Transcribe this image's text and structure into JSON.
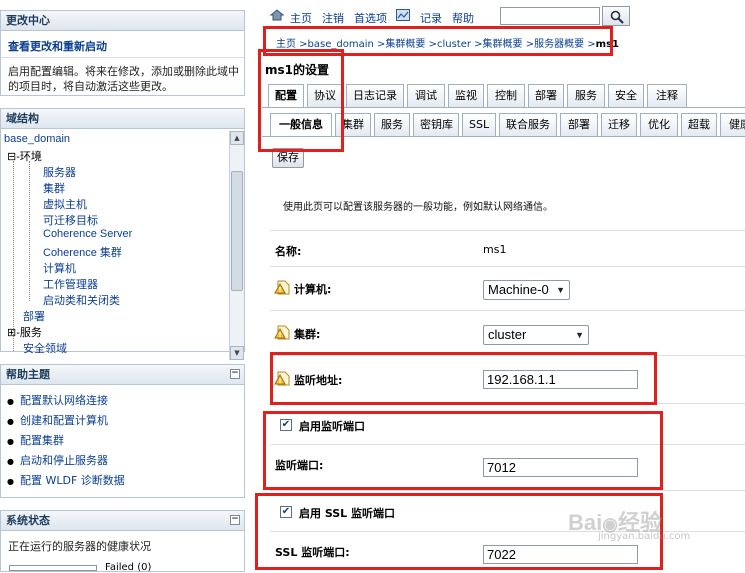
{
  "change_center": {
    "title": "更改中心",
    "link": "查看更改和重新启动",
    "description_line1": "启用配置编辑。将来在修改，添加或删除此域中",
    "description_line2": "的项目时，将自动激活这些更改。"
  },
  "domain_structure": {
    "title": "域结构",
    "items": [
      {
        "label": "base_domain"
      },
      {
        "label": "⊟-环境"
      },
      {
        "label": "服务器"
      },
      {
        "label": "集群"
      },
      {
        "label": "虚拟主机"
      },
      {
        "label": "可迁移目标"
      },
      {
        "label": "Coherence Server"
      },
      {
        "label": "Coherence 集群"
      },
      {
        "label": "计算机"
      },
      {
        "label": "工作管理器"
      },
      {
        "label": "启动类和关闭类"
      },
      {
        "label": "部署"
      },
      {
        "label": "⊞-服务"
      },
      {
        "label": "安全领域"
      }
    ]
  },
  "help_topics": {
    "title": "帮助主题",
    "items": [
      "配置默认网络连接",
      "创建和配置计算机",
      "配置集群",
      "启动和停止服务器",
      "配置 WLDF 诊断数据"
    ]
  },
  "system_status": {
    "title": "系统状态",
    "subtitle": "正在运行的服务器的健康状况",
    "partial": "Failed (0)"
  },
  "toolbar": {
    "home": "主页",
    "logout": "注销",
    "preferences": "首选项",
    "record": "记录",
    "help": "帮助"
  },
  "breadcrumb": {
    "path": "主页 >base_domain >集群概要 >cluster >集群概要 >服务器概要 >",
    "current": "ms1"
  },
  "settings_title": "ms1的设置",
  "tabs_top": [
    "配置",
    "协议",
    "日志记录",
    "调试",
    "监视",
    "控制",
    "部署",
    "服务",
    "安全",
    "注释"
  ],
  "tabs_sub": [
    "一般信息",
    "集群",
    "服务",
    "密钥库",
    "SSL",
    "联合服务",
    "部署",
    "迁移",
    "优化",
    "超载",
    "健康"
  ],
  "save_label": "保存",
  "description": "使用此页可以配置该服务器的一般功能，例如默认网络通信。",
  "fields": {
    "name_label": "名称:",
    "name_value": "ms1",
    "machine_label": "计算机:",
    "machine_value": "Machine-0",
    "cluster_label": "集群:",
    "cluster_value": "cluster",
    "listen_address_label": "监听地址:",
    "listen_address_value": "192.168.1.1",
    "listen_port_enabled_label": "启用监听端口",
    "listen_port_label": "监听端口:",
    "listen_port_value": "7012",
    "ssl_enabled_label": "启用  SSL 监听端口",
    "ssl_port_label": "SSL 监听端口:",
    "ssl_port_value": "7022"
  },
  "colors": {
    "highlight_red": "#e0201c",
    "link_blue": "#0a3f92",
    "panel_border": "#b9c5d3"
  },
  "watermark": "Baidu 经验  jingyan.baidu.com"
}
